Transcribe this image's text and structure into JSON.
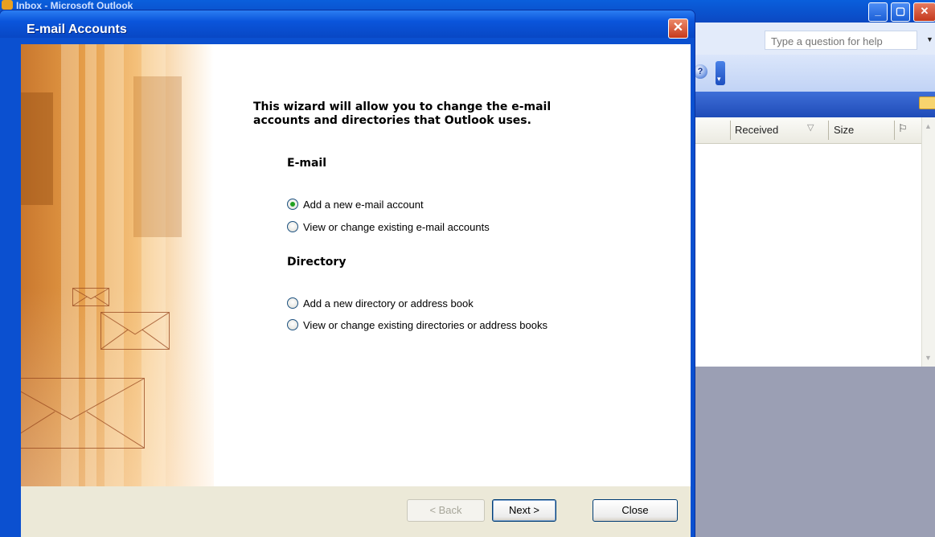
{
  "background": {
    "title_ghost": "Inbox - Microsoft Outlook",
    "help_box_placeholder": "Type a question for help",
    "help_icon": "?",
    "columns": {
      "received": "Received",
      "size": "Size"
    },
    "icons": {
      "minimize": "minimize-icon",
      "maximize": "maximize-icon",
      "close": "close-icon",
      "sort": "sort-arrow-icon",
      "filter": "flag-icon",
      "folder": "folder-icon"
    }
  },
  "dialog": {
    "title": "E-mail Accounts",
    "close_glyph": "✕",
    "intro": "This wizard will allow you to change the e-mail accounts and directories that Outlook uses.",
    "email_section": {
      "title": "E-mail",
      "options": [
        {
          "label": "Add a new e-mail account",
          "checked": true
        },
        {
          "label": "View or change existing e-mail accounts",
          "checked": false
        }
      ]
    },
    "directory_section": {
      "title": "Directory",
      "options": [
        {
          "label": "Add a new directory or address book",
          "checked": false
        },
        {
          "label": "View or change existing directories or address books",
          "checked": false
        }
      ]
    },
    "buttons": {
      "back": "< Back",
      "next": "Next >",
      "close": "Close"
    }
  },
  "colors": {
    "xp_blue": "#0a55db",
    "dialog_face": "#ece9d8",
    "radio_selected": "#21a121",
    "close_red": "#c6391c"
  }
}
